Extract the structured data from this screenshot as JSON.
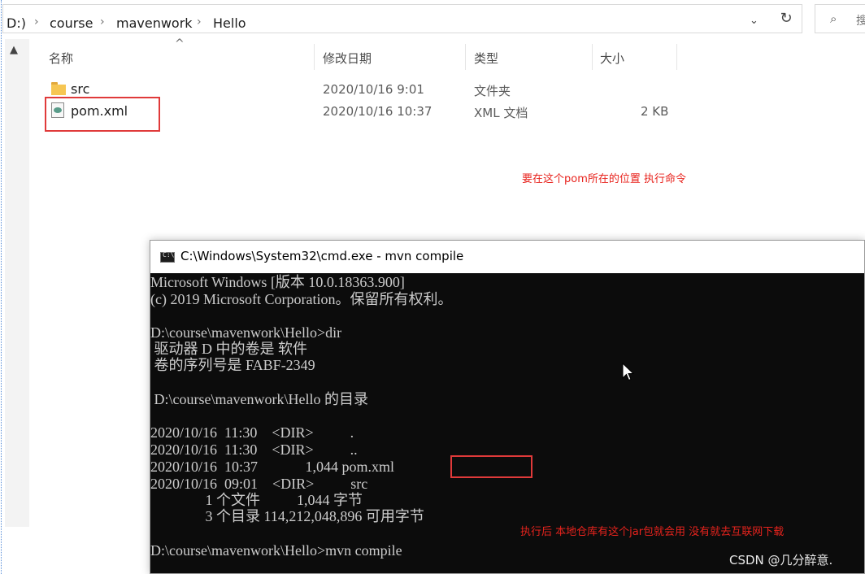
{
  "explorer": {
    "breadcrumb": [
      "D:)",
      "course",
      "mavenwork",
      "Hello"
    ],
    "search_placeholder": "搜",
    "columns": {
      "name": "名称",
      "date": "修改日期",
      "type": "类型",
      "size": "大小"
    },
    "files": [
      {
        "name": "src",
        "date": "2020/10/16 9:01",
        "type": "文件夹",
        "size": "",
        "icon": "folder-icon"
      },
      {
        "name": "pom.xml",
        "date": "2020/10/16 10:37",
        "type": "XML 文档",
        "size": "2 KB",
        "icon": "xml-file-icon"
      }
    ]
  },
  "annotations": {
    "pom_location_note": "要在这个pom所在的位置 执行命令",
    "download_note": "执行后 本地仓库有这个jar包就会用 没有就去互联网下载"
  },
  "cmd": {
    "title": "C:\\Windows\\System32\\cmd.exe - mvn  compile",
    "lines": [
      "Microsoft Windows [版本 10.0.18363.900]",
      "(c) 2019 Microsoft Corporation。保留所有权利。",
      "",
      "D:\\course\\mavenwork\\Hello>dir",
      " 驱动器 D 中的卷是 软件",
      " 卷的序列号是 FABF-2349",
      "",
      " D:\\course\\mavenwork\\Hello 的目录",
      "",
      "2020/10/16  11:30    <DIR>          .",
      "2020/10/16  11:30    <DIR>          ..",
      "2020/10/16  10:37             1,044 pom.xml",
      "2020/10/16  09:01    <DIR>          src",
      "               1 个文件          1,044 字节",
      "               3 个目录 114,212,048,896 可用字节",
      "",
      "D:\\course\\mavenwork\\Hello>mvn compile"
    ]
  },
  "watermark": "CSDN @几分醉意."
}
